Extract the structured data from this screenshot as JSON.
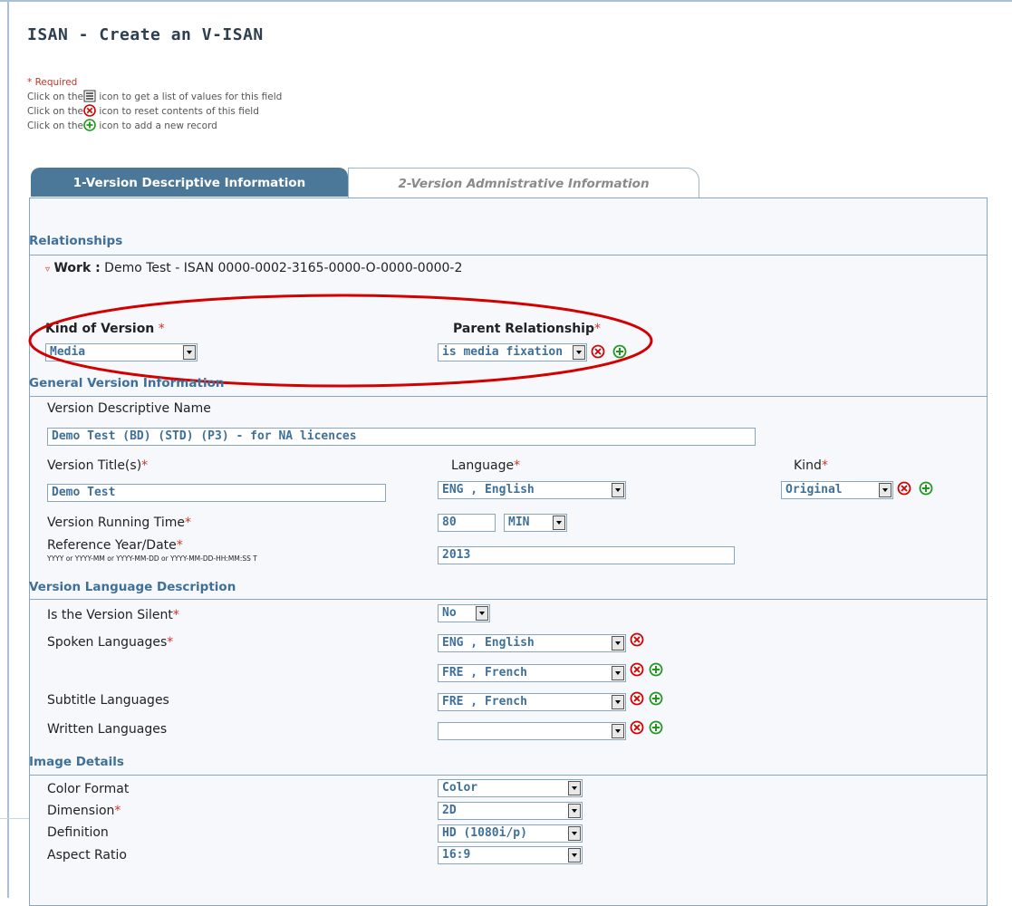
{
  "page": {
    "title": "ISAN - Create an V-ISAN"
  },
  "legend": {
    "required": "* Required",
    "list_pre": "Click on the",
    "list_post": " icon to get a list of values for this field",
    "reset_pre": "Click on the",
    "reset_post": " icon to reset contents of this field",
    "add_pre": "Click on the",
    "add_post": " icon to add a new record"
  },
  "tabs": [
    {
      "label": "1-Version Descriptive Information",
      "active": true
    },
    {
      "label": "2-Version Admnistrative Information",
      "active": false
    }
  ],
  "relationships": {
    "heading": "Relationships",
    "work_label": "Work :",
    "work_value": " Demo Test - ISAN 0000-0002-3165-0000-O-0000-0000-2",
    "kind_of_version_label": "Kind of Version",
    "kind_of_version_value": "Media",
    "parent_relationship_label": "Parent Relationship",
    "parent_relationship_value": "is media fixation"
  },
  "general": {
    "heading": "General Version Information",
    "descriptive_name_label": "Version Descriptive Name",
    "descriptive_name_value": "Demo Test (BD) (STD) (P3) - for NA licences",
    "title_label": "Version Title(s)",
    "title_value": "Demo Test",
    "language_label": "Language",
    "language_value": "ENG , English",
    "kind_label": "Kind",
    "kind_value": "Original",
    "running_time_label": "Version Running Time",
    "running_time_value": "80",
    "running_time_unit": "MIN",
    "ref_year_label": "Reference Year/Date",
    "ref_year_hint": "YYYY or YYYY-MM or YYYY-MM-DD or YYYY-MM-DD-HH:MM:SS T",
    "ref_year_value": "2013"
  },
  "language_desc": {
    "heading": "Version Language Description",
    "silent_label": "Is the Version Silent",
    "silent_value": "No",
    "spoken_label": "Spoken Languages",
    "spoken_values": [
      "ENG , English",
      "FRE , French"
    ],
    "subtitle_label": "Subtitle Languages",
    "subtitle_value": "FRE , French",
    "written_label": "Written Languages",
    "written_value": ""
  },
  "image": {
    "heading": "Image Details",
    "color_label": "Color Format",
    "color_value": "Color",
    "dimension_label": "Dimension",
    "dimension_value": "2D",
    "definition_label": "Definition",
    "definition_value": "HD (1080i/p)",
    "aspect_label": "Aspect Ratio",
    "aspect_value": "16:9"
  },
  "colors": {
    "accent": "#3f7099",
    "tab_active": "#4b7798",
    "required": "#d0352b",
    "oval": "#d40000"
  }
}
